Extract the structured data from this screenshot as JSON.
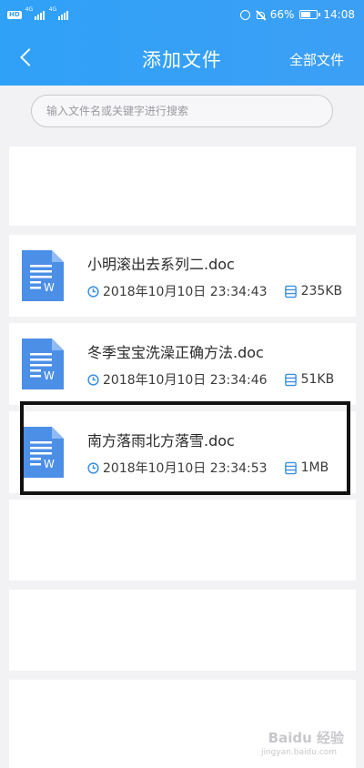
{
  "status_bar": {
    "hd_badge": "HD",
    "network1": "4G",
    "network2": "4G",
    "battery_percent": "66%",
    "battery_level": 0.66,
    "time": "14:08"
  },
  "nav": {
    "back_icon": "chevron-left-icon",
    "title": "添加文件",
    "right_label": "全部文件"
  },
  "search": {
    "placeholder": "输入文件名或关键字进行搜索"
  },
  "files": [
    {
      "name": "小明滚出去系列二.doc",
      "datetime": "2018年10月10日 23:34:43",
      "size": "235KB",
      "icon": "word-doc-icon"
    },
    {
      "name": "冬季宝宝洗澡正确方法.doc",
      "datetime": "2018年10月10日 23:34:46",
      "size": "51KB",
      "icon": "word-doc-icon"
    },
    {
      "name": "南方落雨北方落雪.doc",
      "datetime": "2018年10月10日 23:34:53",
      "size": "1MB",
      "icon": "word-doc-icon"
    }
  ],
  "watermark": {
    "brand": "Baidu 经验",
    "url": "jingyan.baidu.com"
  },
  "colors": {
    "header_blue": "#3a9ff6",
    "doc_icon_blue": "#4b8fe6",
    "meta_icon_blue": "#3a8fe0",
    "highlight_border": "#111111"
  }
}
